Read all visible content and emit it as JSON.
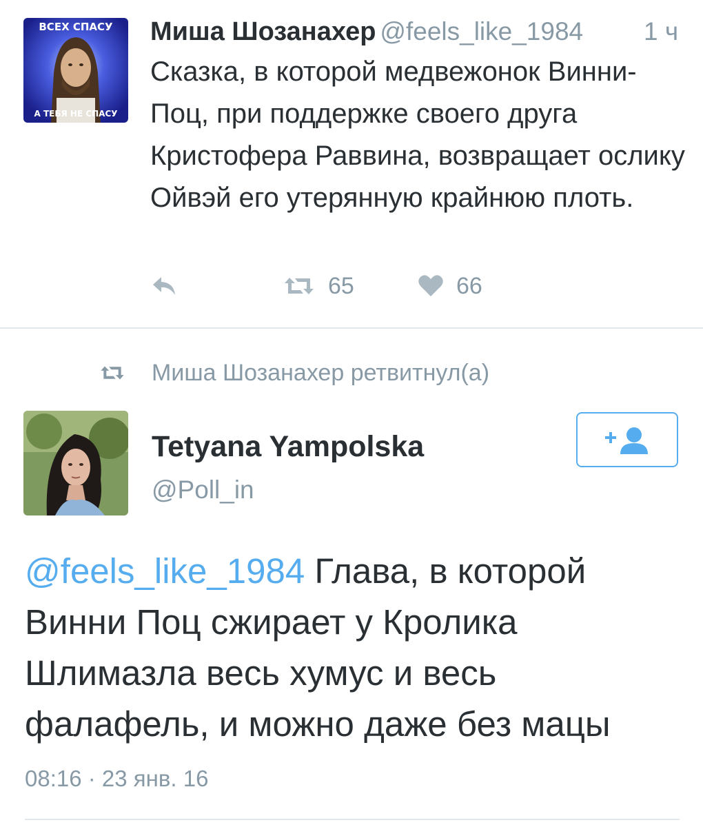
{
  "tweet1": {
    "author_name": "Миша Шозанахер",
    "handle": "@feels_like_1984",
    "time": "1 ч",
    "avatar_caption_top": "ВСЕХ СПАСУ",
    "avatar_caption_bottom": "А ТЕБЯ НЕ СПАСУ",
    "text": "Сказка, в которой медвежонок Винни-Поц, при поддержке своего друга Кристофера Раввина, возвращает ослику Ойвэй его утерянную крайнюю плоть.",
    "retweet_count": "65",
    "like_count": "66",
    "icons": [
      "reply-icon",
      "retweet-icon",
      "heart-icon"
    ]
  },
  "retweet_context": {
    "text": "Миша Шозанахер ретвитнул(а)",
    "icon": "retweet-icon"
  },
  "tweet2": {
    "author_name": "Tetyana Yampolska",
    "handle": "@Poll_in",
    "follow_icon": "follow-user-icon",
    "mention": "@feels_like_1984",
    "text": " Глава, в которой Винни Поц сжирает у Кролика Шлимазла весь хумус и весь фалафель, и можно даже без мацы",
    "timestamp": "08:16 · 23 янв. 16"
  },
  "colors": {
    "accent": "#55acee",
    "muted": "#8899a6",
    "text": "#292f33",
    "divider": "#e1e8ed"
  }
}
